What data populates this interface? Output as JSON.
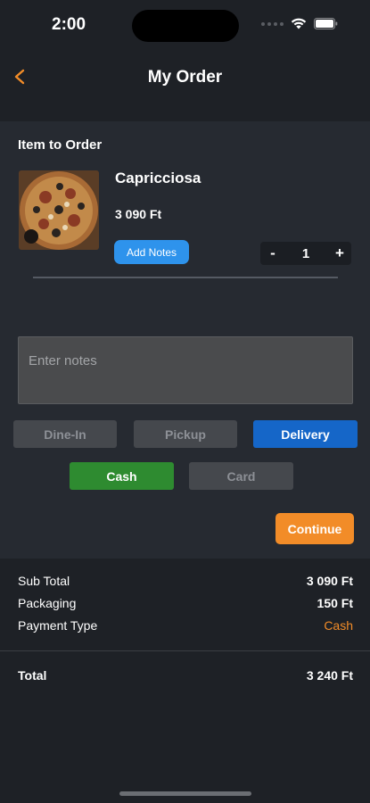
{
  "status_bar": {
    "time": "2:00"
  },
  "header": {
    "title": "My Order",
    "accent_color": "#f28c28"
  },
  "order": {
    "section_title": "Item to Order",
    "item": {
      "name": "Capricciosa",
      "price": "3 090 Ft",
      "add_notes_label": "Add Notes",
      "quantity": "1",
      "minus_label": "-",
      "plus_label": "+"
    },
    "notes_placeholder": "Enter notes",
    "order_types": [
      {
        "label": "Dine-In",
        "selected": false
      },
      {
        "label": "Pickup",
        "selected": false
      },
      {
        "label": "Delivery",
        "selected": true
      }
    ],
    "payment_methods": [
      {
        "label": "Cash",
        "selected": true
      },
      {
        "label": "Card",
        "selected": false
      }
    ],
    "continue_label": "Continue"
  },
  "summary": {
    "sub_total_label": "Sub Total",
    "sub_total_value": "3 090 Ft",
    "packaging_label": "Packaging",
    "packaging_value": "150 Ft",
    "payment_type_label": "Payment Type",
    "payment_type_value": "Cash",
    "total_label": "Total",
    "total_value": "3 240 Ft"
  },
  "colors": {
    "background": "#1e2126",
    "panel": "#262a31",
    "delivery_selected": "#1566c8",
    "cash_selected": "#2e8b30",
    "continue": "#f28c28",
    "add_notes": "#2e93ec"
  }
}
